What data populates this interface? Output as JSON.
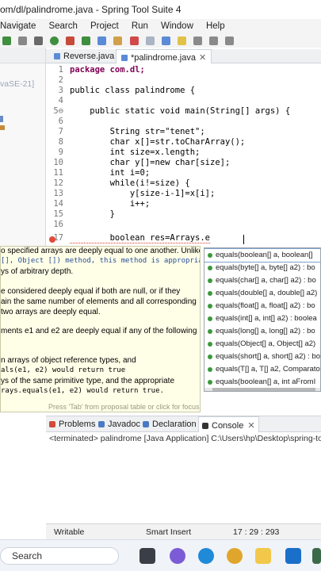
{
  "window": {
    "title": "om/dl/palindrome.java - Spring Tool Suite 4"
  },
  "menu": [
    "Navigate",
    "Search",
    "Project",
    "Run",
    "Window",
    "Help"
  ],
  "left_panel": {
    "jre_label": "vaSE-21]"
  },
  "editor_tabs": [
    {
      "label": "Reverse.java"
    },
    {
      "label": "*palindrome.java",
      "close": "✕"
    }
  ],
  "code_lines": [
    {
      "num": "1",
      "text": "package com.dl;"
    },
    {
      "num": "2",
      "text": ""
    },
    {
      "num": "3",
      "text": "public class palindrome {"
    },
    {
      "num": "4",
      "text": ""
    },
    {
      "num": "5⊖",
      "text": "    public static void main(String[] args) {"
    },
    {
      "num": "6",
      "text": ""
    },
    {
      "num": "7",
      "text": "        String str=\"tenet\";"
    },
    {
      "num": "8",
      "text": "        char x[]=str.toCharArray();"
    },
    {
      "num": "9",
      "text": "        int size=x.length;"
    },
    {
      "num": "10",
      "text": "        char y[]=new char[size];"
    },
    {
      "num": "11",
      "text": "        int i=0;"
    },
    {
      "num": "12",
      "text": "        while(i!=size) {"
    },
    {
      "num": "13",
      "text": "            y[size-i-1]=x[i];"
    },
    {
      "num": "14",
      "text": "            i++;"
    },
    {
      "num": "15",
      "text": "        }"
    },
    {
      "num": "16",
      "text": ""
    },
    {
      "num": "17",
      "text": "        boolean res=Arrays.e"
    }
  ],
  "javadoc": {
    "lines": [
      "o specified arrays are deeply equal to one another. Unlike",
      "[], Object []) method, this method is appropriate",
      "ys of arbitrary depth.",
      "",
      "e considered deeply equal if both are null, or if they",
      "ain the same number of elements and all corresponding",
      " two arrays are deeply equal.",
      "",
      "ments e1 and e2 are deeply equal if any of the following",
      "",
      "",
      "n arrays of object reference types, and",
      "als(e1, e2) would return true",
      "ys of the same primitive type, and the appropriate",
      "rays.equals(e1, e2) would return true."
    ],
    "footer": "Press 'Tab' from proposal table or click for focus"
  },
  "proposals": [
    "equals(boolean[] a, boolean[]",
    "equals(byte[] a, byte[] a2) : bo",
    "equals(char[] a, char[] a2) : bo",
    "equals(double[] a, double[] a2)",
    "equals(float[] a, float[] a2) : bo",
    "equals(int[] a, int[] a2) : boolea",
    "equals(long[] a, long[] a2) : bo",
    "equals(Object[] a, Object[] a2)",
    "equals(short[] a, short[] a2) : bo",
    "equals(T[] a, T[] a2, Comparato",
    "equals(boolean[] a, int aFromI"
  ],
  "bottom_tabs": [
    "Problems",
    "Javadoc",
    "Declaration",
    "Console"
  ],
  "console": {
    "text": "<terminated> palindrome [Java Application] C:\\Users\\hp\\Desktop\\spring-tool"
  },
  "status": {
    "writable": "Writable",
    "insert_mode": "Smart Insert",
    "position": "17 : 29 : 293"
  },
  "taskbar": {
    "search_label": "Search"
  }
}
